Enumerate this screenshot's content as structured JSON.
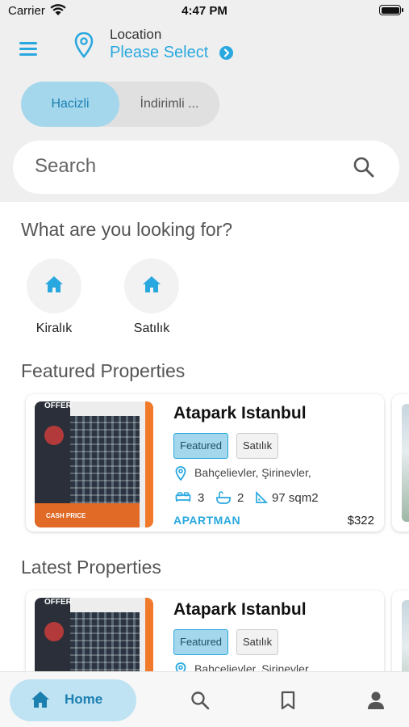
{
  "status_bar": {
    "carrier": "Carrier",
    "time": "4:47 PM"
  },
  "header": {
    "location_label": "Location",
    "location_value": "Please Select"
  },
  "segmented": {
    "options": [
      "Hacizli",
      "İndirimli ..."
    ],
    "selected": 0
  },
  "search": {
    "placeholder": "Search"
  },
  "sections": {
    "looking_for": "What are you looking for?",
    "featured": "Featured Properties",
    "latest": "Latest Properties"
  },
  "categories": [
    {
      "label": "Kiralık",
      "icon": "home-icon"
    },
    {
      "label": "Satılık",
      "icon": "home-icon"
    }
  ],
  "featured": [
    {
      "title": "Atapark Istanbul",
      "tags": [
        "Featured",
        "Satılık"
      ],
      "address": "Bahçelievler, Şirinevler,",
      "beds": "3",
      "baths": "2",
      "area": "97 sqm2",
      "type": "APARTMAN",
      "price": "$322",
      "image_text": {
        "offer": "OFFER",
        "cash": "CASH PRICE"
      }
    }
  ],
  "latest": [
    {
      "title": "Atapark Istanbul",
      "tags": [
        "Featured",
        "Satılık"
      ],
      "address": "Bahçelievler, Şirinevler,",
      "image_text": {
        "offer": "OFFER"
      }
    }
  ],
  "tab_bar": {
    "home_label": "Home",
    "items": [
      "home-icon",
      "search-icon",
      "bookmark-icon",
      "person-icon"
    ]
  },
  "colors": {
    "accent": "#29a8df",
    "accent_light": "#a4d7ec",
    "header_bg": "#efefef"
  }
}
